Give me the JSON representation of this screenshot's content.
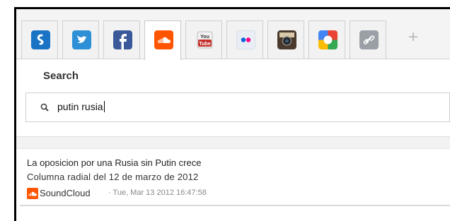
{
  "tabs": [
    {
      "name": "shazam",
      "icon": "shazam-icon",
      "color": "#1a73c5",
      "active": false
    },
    {
      "name": "twitter",
      "icon": "twitter-icon",
      "color": "#2d8fd5",
      "active": false
    },
    {
      "name": "facebook",
      "icon": "facebook-icon",
      "color": "#3b5998",
      "active": false
    },
    {
      "name": "soundcloud",
      "icon": "soundcloud-icon",
      "color": "#ff5500",
      "active": true
    },
    {
      "name": "youtube",
      "icon": "youtube-icon",
      "color": "#c4302b",
      "label": "You Tube",
      "active": false
    },
    {
      "name": "flickr",
      "icon": "flickr-icon",
      "color": "#e8eef4",
      "active": false
    },
    {
      "name": "instagram",
      "icon": "instagram-icon",
      "color": "#4a3a2e",
      "active": false
    },
    {
      "name": "google",
      "icon": "google-icon",
      "color": "#ea4335",
      "active": false
    },
    {
      "name": "link",
      "icon": "link-icon",
      "color": "#9aa0a6",
      "active": false
    }
  ],
  "add_tab": {
    "label": "+"
  },
  "search": {
    "label": "Search",
    "value": "putin rusia"
  },
  "results": [
    {
      "title": "La oposicion por una Rusia sin Putin crece",
      "description": "Columna radial del 12 de marzo de 2012",
      "source": "SoundCloud",
      "meta": "· Tue, Mar 13 2012 16:47:58"
    }
  ]
}
